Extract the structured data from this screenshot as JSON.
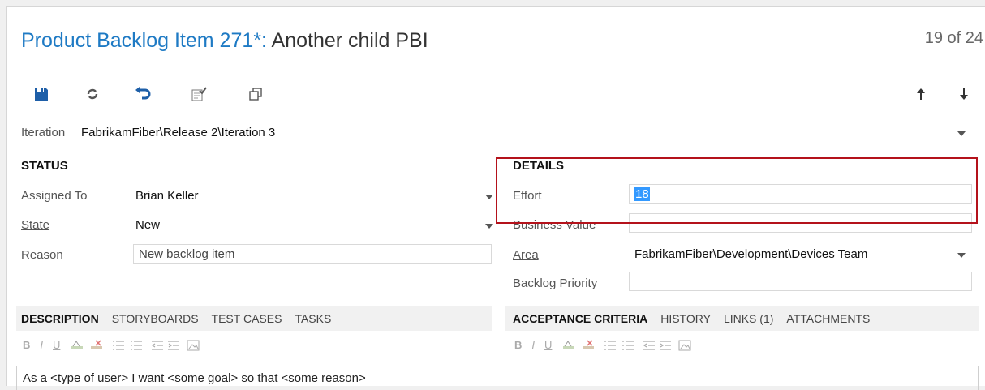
{
  "header": {
    "title_prefix": "Product Backlog Item 271*: ",
    "title_name": "Another child PBI",
    "paging": "19 of 24"
  },
  "iteration": {
    "label": "Iteration",
    "value": "FabrikamFiber\\Release 2\\Iteration 3"
  },
  "status": {
    "heading": "STATUS",
    "assigned_to": {
      "label": "Assigned To",
      "value": "Brian Keller"
    },
    "state": {
      "label": "State",
      "value": "New"
    },
    "reason": {
      "label": "Reason",
      "value": "New backlog item"
    }
  },
  "details": {
    "heading": "DETAILS",
    "effort": {
      "label": "Effort",
      "value": "18"
    },
    "business_value": {
      "label": "Business Value",
      "value": ""
    },
    "area": {
      "label": "Area",
      "value": "FabrikamFiber\\Development\\Devices Team"
    },
    "backlog_priority": {
      "label": "Backlog Priority",
      "value": ""
    }
  },
  "left_tabs": [
    "DESCRIPTION",
    "STORYBOARDS",
    "TEST CASES",
    "TASKS"
  ],
  "right_tabs": [
    "ACCEPTANCE CRITERIA",
    "HISTORY",
    "LINKS (1)",
    "ATTACHMENTS"
  ],
  "format_bar": {
    "bold": "B",
    "italic": "I",
    "underline": "U"
  },
  "description_text": "As a <type of user> I want <some goal> so that <some reason>",
  "colors": {
    "accent": "#1e7ac4",
    "highlight": "#b4121b",
    "selection": "#3399ff"
  },
  "toolbar_icons": [
    "save-icon",
    "refresh-icon",
    "undo-icon",
    "query-icon",
    "copy-icon",
    "arrow-up-icon",
    "arrow-down-icon"
  ]
}
